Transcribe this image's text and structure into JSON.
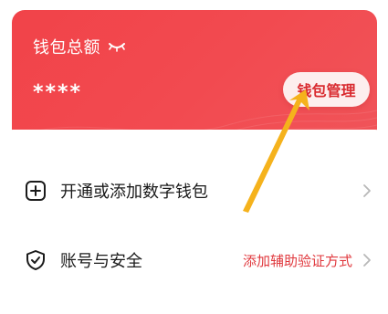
{
  "wallet": {
    "title": "钱包总额",
    "balance_masked": "****",
    "manage_button": "钱包管理",
    "eye_icon": "eye-closed-icon"
  },
  "menu": [
    {
      "label": "开通或添加数字钱包",
      "icon": "plus-square-icon",
      "hint": ""
    },
    {
      "label": "账号与安全",
      "icon": "shield-check-icon",
      "hint": "添加辅助验证方式"
    }
  ],
  "colors": {
    "card": "#f14349",
    "accent_text": "#e0383d",
    "annotation_arrow": "#f5b21c"
  }
}
